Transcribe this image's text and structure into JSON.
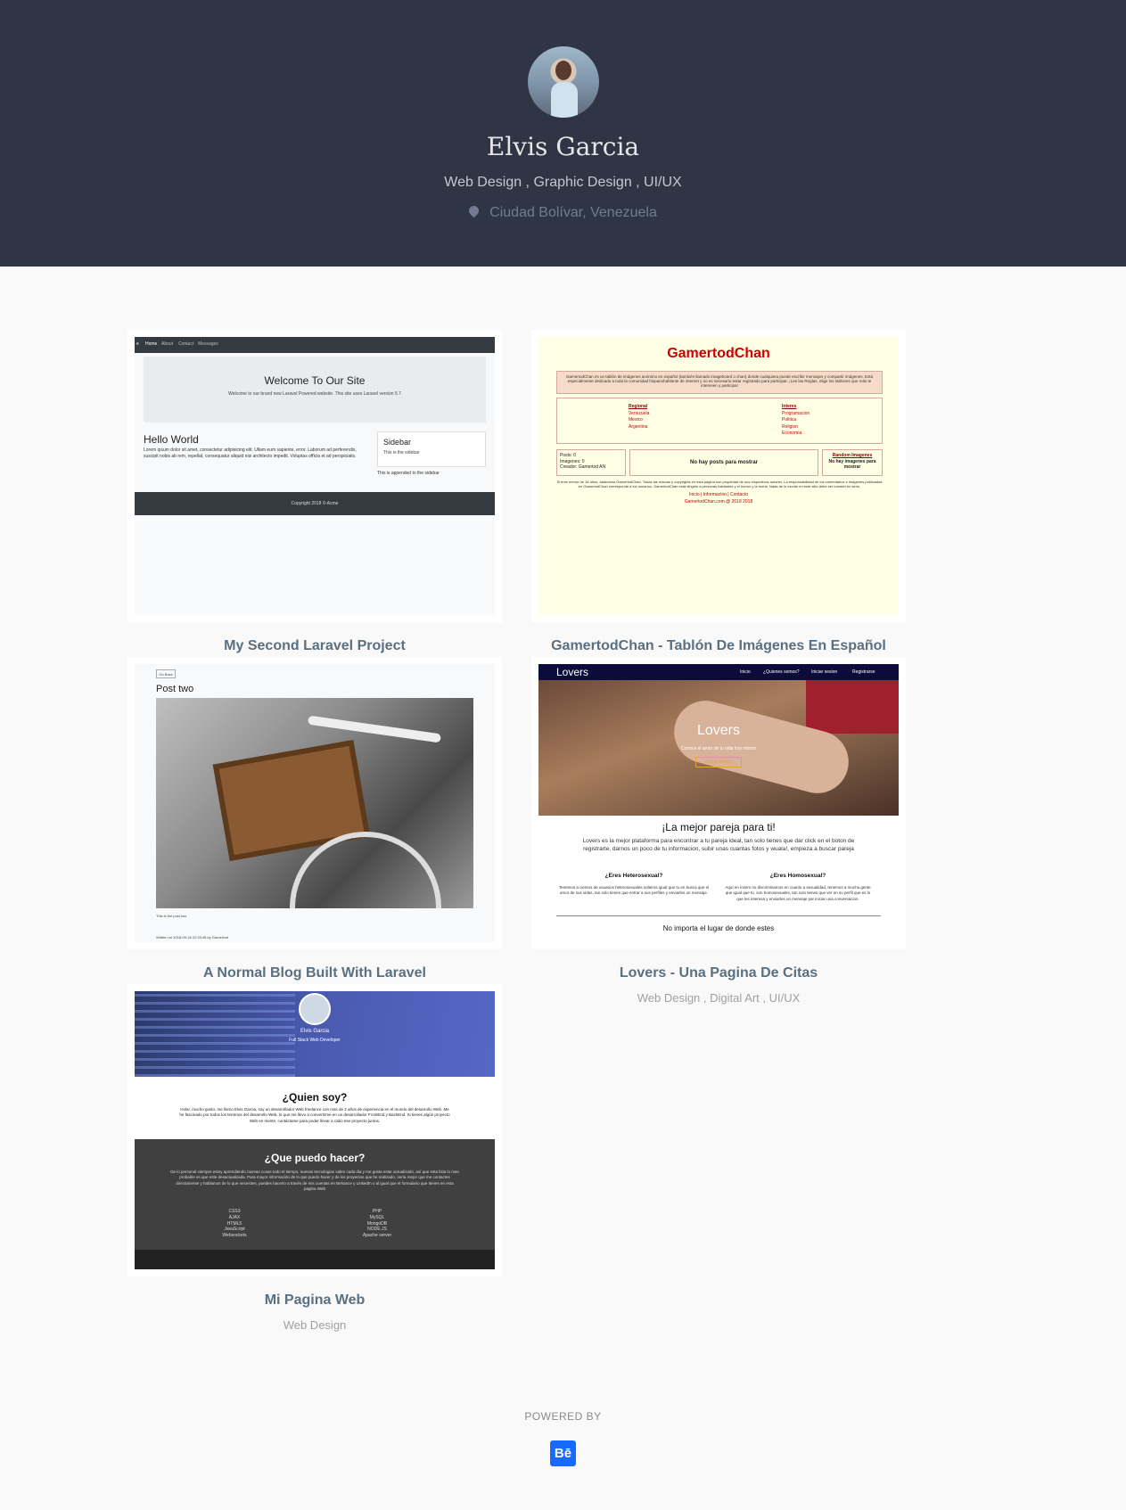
{
  "profile": {
    "name": "Elvis Garcia",
    "fields": "Web Design , Graphic Design , UI/UX",
    "location": "Ciudad Bolívar, Venezuela",
    "location_icon": "location-pin-icon"
  },
  "projects": [
    {
      "title": "My Second Laravel Project",
      "fields": "",
      "thumb": {
        "nav": [
          "Home",
          "About",
          "Contact",
          "Messages"
        ],
        "jumbo_title": "Welcome To Our Site",
        "jumbo_text": "Welcome to our brand new Laravel Powered website. This site uses Laravel version 5.7",
        "heading": "Hello World",
        "lorem": "Lorem ipsum dolor sit amet, consectetur adipisicing elit. Ullam eum sapiente, error. Laborum ad perferendis, suscipit nobis ab rem, repellat, consequatur aliquid nisi architecto impedit. Voluptas officia et ad perspiciatis.",
        "sidebar_title": "Sidebar",
        "sidebar_text": "This is the sidebar",
        "appended": "This is appended to the sidebar",
        "copyright": "Copyright 2018 © Acme"
      }
    },
    {
      "title": "GamertodChan - Tablón De Imágenes En Español",
      "fields": "",
      "thumb": {
        "heading": "GamertodChan",
        "intro": "GamertodChan es un tablón de imágenes anónimo en español (también llamado imageboard o chan) donde cualquiera puede escribir mensajes y compartir imágenes. Está especialmente dedicado a toda la comunidad hispanohablante de internet y no es necesario estar registrado para participar. ¡Lee las Reglas, elige los tablones que más te interesen y participa!",
        "regional_label": "Regional",
        "regional": [
          "Venezuela",
          "Mexico",
          "Argentina"
        ],
        "interes_label": "Interes",
        "interes": [
          "Programacion",
          "Politica",
          "Religion",
          "Economia"
        ],
        "stats": [
          "Posts: 0",
          "Imagenes: 0",
          "Creador: Gamertod AN"
        ],
        "no_posts": "No hay posts para mostrar",
        "random_label": "Random Imagenes",
        "no_images": "No hay imagenes para mostrar",
        "disclaimer": "Si eres menor de 18 años, abandona GamertodChan. Todas las marcas y copyrights en esta página son propiedad de sus respectivos autores. La responsabilidad de los comentarios e imágenes publicadas en GamertodChan corresponde a los usuarios. GamertodChan está dirigido a personas hablantes y el humor y la moral. Nada de lo escrito en este sitio debe ser tomado en serio.",
        "links": "Inicio | Informacion | Contacto",
        "copy": "GamertodChan.com @ 2018 2018"
      }
    },
    {
      "title": "A Normal Blog Built With Laravel",
      "fields": "",
      "thumb": {
        "back": "Go Back",
        "post_title": "Post two",
        "caption": "This is the post two",
        "written": "Written on 2018-09-16 22:33:45 by GamerIvel"
      }
    },
    {
      "title": "Lovers - Una Pagina De Citas",
      "fields": "Web Design , Digital Art , UI/UX",
      "thumb": {
        "brand": "Lovers",
        "nav": [
          "Inicio",
          "¿Quienes somos?",
          "Iniciar sesion",
          "Registrarse"
        ],
        "hero_title": "Lovers",
        "hero_sub": "Conoce el amor de tu vida hoy mismo",
        "hero_btn": "Iniciar sesion",
        "headline": "¡La mejor pareja para ti!",
        "intro": "Lovers es la mejor plataforma para encontrar a tu pareja ideal, tan solo tienes que dar click en el boton de registrarte, darnos un poco de tu informacion, subir unas cuantas fotos y wuala!, empieza a buscar pareja",
        "col1_title": "¿Eres Heterosexual?",
        "col1_text": "Tenemos a cientos de usuarios heterosexuales solteros igual que tu en busca que el amor de sus vidas, tan solo tienes que entrar a sus perfiles y enviarles un mensaje.",
        "col2_title": "¿Eres Homosexual?",
        "col2_text": "Aquí en lovers no discriminamos en cuanto a sexualidad, tenemos a mucha gente que igual que tu, son homosexuales, tan solo tienes que ver en su perfil que es lo que les interesa y enviarles un mensaje par iniciar una conversacion.",
        "bottom": "No importa el lugar de donde estes"
      }
    },
    {
      "title": "Mi Pagina Web",
      "fields": "Web Design",
      "thumb": {
        "name": "Elvis Garcia",
        "role": "Full Stack Web Developer",
        "q1": "¿Quien soy?",
        "p1": "Hola!, mucho gusto, me llamo Elvis Garcia, soy un desarrollador Web freelance con mas de 2 años de experiencia en el mundo del desarrollo Web. Me he fascinado por todos los terrenos del desarrollo Web, lo que me llevo a convertirme en un desarrollador FrontEnd y BackEnd. Si tienes algún proyecto Web en mente, contáctame para poder llevar a cabo ese proyecto juntos.",
        "q2": "¿Que puedo hacer?",
        "p2": "De lo personal siempre estoy aprendiendo nuevas cosas todo el tiempo, nuevas tecnologias salen cada dia y me gusta estar actualizado, así que esta lista lo mas probable es que este desactualizada. Para mayor información de lo que puedo hacer y de los proyectos que he realizado, sería mejor que me contactes directamente y hablamos de lo que necesites, puedes hacerlo a través de mis cuentas en Behance y LinkedIn o al igual que el formulario que tienes en esta pagina Web",
        "left_list": [
          "CSS3",
          "AJAX",
          "HTML5",
          "JavaScript",
          "Websockets"
        ],
        "right_list": [
          "PHP",
          "MySQL",
          "MongoDB",
          "NODE.JS",
          "Apache server"
        ]
      }
    }
  ],
  "footer": {
    "powered_by": "POWERED BY",
    "brand_glyph": "Bē",
    "brand_icon": "behance-icon"
  },
  "colors": {
    "header_bg": "#2f3545",
    "page_bg": "#f9f9f9",
    "title": "#5a6f80",
    "behance": "#1769ff"
  }
}
